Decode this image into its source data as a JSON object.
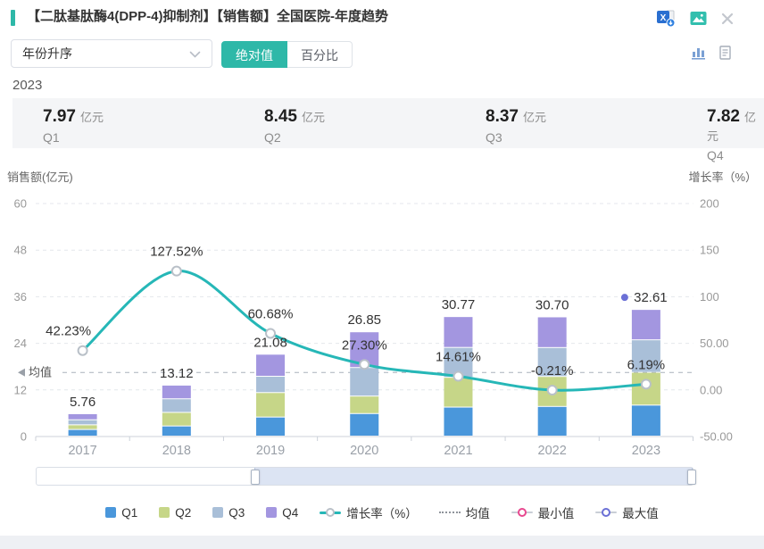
{
  "header": {
    "title": "【二肽基肽酶4(DPP-4)抑制剂】【销售额】全国医院-年度趋势",
    "accent_color": "#2eb8a8"
  },
  "controls": {
    "sort_value": "年份升序",
    "mode_options": [
      "绝对值",
      "百分比"
    ],
    "mode_active": "绝对值"
  },
  "summary": {
    "year": "2023",
    "items": [
      {
        "label": "Q1",
        "value": "7.97",
        "unit": "亿元"
      },
      {
        "label": "Q2",
        "value": "8.45",
        "unit": "亿元"
      },
      {
        "label": "Q3",
        "value": "8.37",
        "unit": "亿元"
      },
      {
        "label": "Q4",
        "value": "7.82",
        "unit": "亿元"
      }
    ]
  },
  "chart_data": {
    "type": "bar",
    "subtype": "stacked-bars-with-growth-line",
    "categories": [
      "2017",
      "2018",
      "2019",
      "2020",
      "2021",
      "2022",
      "2023"
    ],
    "series": [
      {
        "name": "Q1",
        "color": "#4a97db",
        "values": [
          1.7,
          2.6,
          4.9,
          5.8,
          7.46,
          7.63,
          7.97
        ]
      },
      {
        "name": "Q2",
        "color": "#c6d688",
        "values": [
          1.2,
          3.5,
          6.3,
          4.5,
          7.67,
          7.72,
          8.45
        ]
      },
      {
        "name": "Q3",
        "color": "#a9bfd8",
        "values": [
          1.3,
          3.5,
          4.2,
          7.35,
          7.7,
          7.45,
          8.37
        ]
      },
      {
        "name": "Q4",
        "color": "#a396e0",
        "values": [
          1.56,
          3.52,
          5.68,
          9.2,
          7.94,
          7.9,
          7.82
        ]
      }
    ],
    "totals": [
      5.76,
      13.12,
      21.08,
      26.85,
      30.77,
      30.7,
      32.61
    ],
    "total_labels": [
      "5.76",
      "13.12",
      "21.08",
      "26.85",
      "30.77",
      "30.70",
      "32.61"
    ],
    "growth_line": {
      "name": "增长率（%）",
      "color": "#26b7b7",
      "values": [
        42.23,
        127.52,
        60.68,
        27.3,
        14.61,
        -0.21,
        6.19
      ],
      "labels": [
        "42.23%",
        "127.52%",
        "60.68%",
        "27.30%",
        "14.61%",
        "-0.21%",
        "6.19%"
      ]
    },
    "mean_line": {
      "label": "均值",
      "value": 16.5
    },
    "max_marker": {
      "category": "2023",
      "total": 32.61,
      "color": "#6b70d6"
    },
    "min_marker_color": "#e8488f",
    "left_axis": {
      "title": "销售额(亿元)",
      "ticks": [
        0,
        12,
        24,
        36,
        48,
        60
      ],
      "range": [
        0,
        60
      ]
    },
    "right_axis": {
      "title": "增长率（%）",
      "ticks": [
        "-50.00",
        "0.00",
        "50.00",
        "100",
        "150",
        "200"
      ],
      "range": [
        -50,
        200
      ]
    },
    "x_axis": {
      "labels": [
        "2017",
        "2018",
        "2019",
        "2020",
        "2021",
        "2022",
        "2023"
      ]
    },
    "grid": "horizontal dashed gridlines",
    "legend_position": "bottom"
  },
  "legend": {
    "items": [
      "Q1",
      "Q2",
      "Q3",
      "Q4",
      "增长率（%）",
      "均值",
      "最小值",
      "最大值"
    ]
  },
  "datazoom": {
    "selected_start_pct": 33.2,
    "selected_end_pct": 99.7
  }
}
